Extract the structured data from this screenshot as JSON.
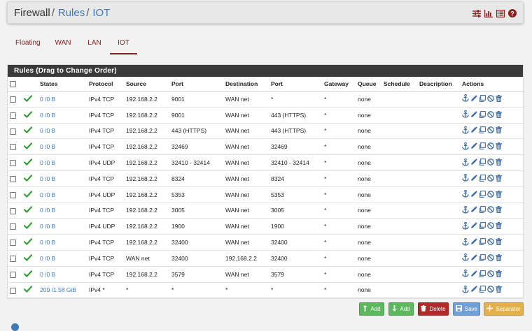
{
  "breadcrumb": {
    "root": "Firewall",
    "section": "Rules",
    "current": "IOT"
  },
  "header_icons": [
    "sliders-icon",
    "bar-chart-icon",
    "list-icon",
    "help-icon"
  ],
  "tabs": [
    {
      "label": "Floating",
      "active": false
    },
    {
      "label": "WAN",
      "active": false
    },
    {
      "label": "LAN",
      "active": false
    },
    {
      "label": "IOT",
      "active": true
    }
  ],
  "panel": {
    "title": "Rules (Drag to Change Order)"
  },
  "columns": [
    "States",
    "Protocol",
    "Source",
    "Port",
    "Destination",
    "Port",
    "Gateway",
    "Queue",
    "Schedule",
    "Description",
    "Actions"
  ],
  "rows": [
    {
      "states": "0 /0 B",
      "protocol": "IPv4 TCP",
      "source": "192.168.2.2",
      "sport": "9001",
      "dest": "WAN net",
      "dport": "*",
      "gateway": "*",
      "queue": "none",
      "schedule": "",
      "description": ""
    },
    {
      "states": "0 /0 B",
      "protocol": "IPv4 TCP",
      "source": "192.168.2.2",
      "sport": "9001",
      "dest": "WAN net",
      "dport": "443 (HTTPS)",
      "gateway": "*",
      "queue": "none",
      "schedule": "",
      "description": ""
    },
    {
      "states": "0 /0 B",
      "protocol": "IPv4 TCP",
      "source": "192.168.2.2",
      "sport": "443 (HTTPS)",
      "dest": "WAN net",
      "dport": "443 (HTTPS)",
      "gateway": "*",
      "queue": "none",
      "schedule": "",
      "description": ""
    },
    {
      "states": "0 /0 B",
      "protocol": "IPv4 TCP",
      "source": "192.168.2.2",
      "sport": "32469",
      "dest": "WAN net",
      "dport": "32469",
      "gateway": "*",
      "queue": "none",
      "schedule": "",
      "description": ""
    },
    {
      "states": "0 /0 B",
      "protocol": "IPv4 UDP",
      "source": "192.168.2.2",
      "sport": "32410 - 32414",
      "dest": "WAN net",
      "dport": "32410 - 32414",
      "gateway": "*",
      "queue": "none",
      "schedule": "",
      "description": ""
    },
    {
      "states": "0 /0 B",
      "protocol": "IPv4 TCP",
      "source": "192.168.2.2",
      "sport": "8324",
      "dest": "WAN net",
      "dport": "8324",
      "gateway": "*",
      "queue": "none",
      "schedule": "",
      "description": ""
    },
    {
      "states": "0 /0 B",
      "protocol": "IPv4 UDP",
      "source": "192.168.2.2",
      "sport": "5353",
      "dest": "WAN net",
      "dport": "5353",
      "gateway": "*",
      "queue": "none",
      "schedule": "",
      "description": ""
    },
    {
      "states": "0 /0 B",
      "protocol": "IPv4 TCP",
      "source": "192.168.2.2",
      "sport": "3005",
      "dest": "WAN net",
      "dport": "3005",
      "gateway": "*",
      "queue": "none",
      "schedule": "",
      "description": ""
    },
    {
      "states": "0 /0 B",
      "protocol": "IPv4 UDP",
      "source": "192.168.2.2",
      "sport": "1900",
      "dest": "WAN net",
      "dport": "1900",
      "gateway": "*",
      "queue": "none",
      "schedule": "",
      "description": ""
    },
    {
      "states": "0 /0 B",
      "protocol": "IPv4 TCP",
      "source": "192.168.2.2",
      "sport": "32400",
      "dest": "WAN net",
      "dport": "32400",
      "gateway": "*",
      "queue": "none",
      "schedule": "",
      "description": ""
    },
    {
      "states": "0 /0 B",
      "protocol": "IPv4 TCP",
      "source": "WAN net",
      "sport": "32400",
      "dest": "192.168.2.2",
      "dport": "32400",
      "gateway": "*",
      "queue": "none",
      "schedule": "",
      "description": ""
    },
    {
      "states": "0 /0 B",
      "protocol": "IPv4 TCP",
      "source": "192.168.2.2",
      "sport": "3579",
      "dest": "WAN net",
      "dport": "3579",
      "gateway": "*",
      "queue": "none",
      "schedule": "",
      "description": ""
    },
    {
      "states": "209 /1.58 GiB",
      "protocol": "IPv4 *",
      "source": "*",
      "sport": "*",
      "dest": "*",
      "dport": "*",
      "gateway": "*",
      "queue": "none",
      "schedule": "",
      "description": ""
    }
  ],
  "buttons": {
    "add_top": "Add",
    "add_bottom": "Add",
    "delete": "Delete",
    "save": "Save",
    "separator": "Separator"
  },
  "colors": {
    "accent": "#8b2020",
    "link": "#3e7ab5",
    "enabled_check": "#2e9e2e",
    "add": "#5cb85c",
    "delete": "#b02a2a",
    "save": "#6f9fd8",
    "separator": "#e3b04b"
  }
}
